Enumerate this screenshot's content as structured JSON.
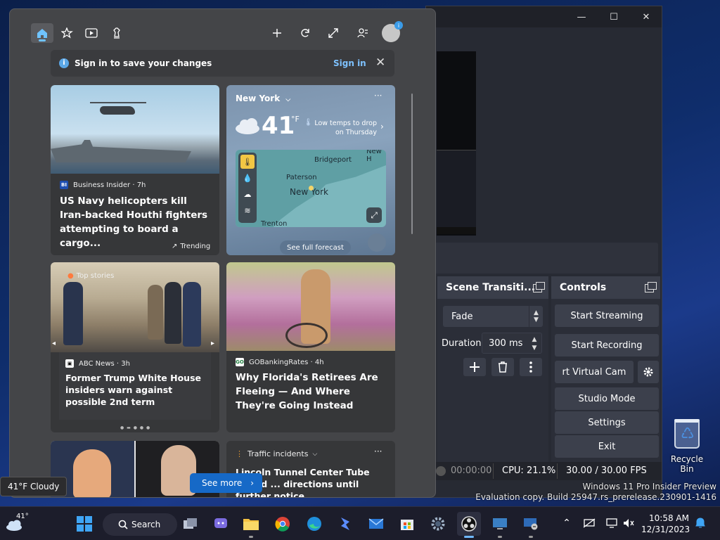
{
  "obs": {
    "window_buttons": {
      "minimize": "—",
      "maximize": "☐",
      "close": "✕"
    },
    "transitions": {
      "title": "Scene Transiti...",
      "selected": "Fade",
      "duration_label": "Duration",
      "duration_value": "300 ms"
    },
    "controls": {
      "title": "Controls",
      "buttons": [
        "Start Streaming",
        "Start Recording",
        "rt Virtual Cam",
        "Studio Mode",
        "Settings",
        "Exit"
      ]
    },
    "status": {
      "rec_time": "00:00:00",
      "cpu": "CPU: 21.1%",
      "fps": "30.00 / 30.00 FPS"
    }
  },
  "desktop": {
    "recycle_bin_label": "Recycle Bin",
    "watermark": [
      "Windows 11 Pro Insider Preview",
      "Evaluation copy. Build 25947.rs_prerelease.230901-1416"
    ]
  },
  "widgets": {
    "signin_bar": {
      "text": "Sign in to save your changes",
      "link": "Sign in"
    },
    "cards": {
      "navy": {
        "source": "Business Insider · 7h",
        "source_logo": "BI",
        "headline": "US Navy helicopters kill Iran-backed Houthi fighters attempting to board a cargo...",
        "tag": "Trending"
      },
      "weather": {
        "location": "New York",
        "temp": "41",
        "unit": "°F",
        "note_line1": "Low temps to drop",
        "note_line2": "on Thursday",
        "map_labels": {
          "bridgeport": "Bridgeport",
          "paterson": "Paterson",
          "newyork": "New York",
          "newh": "New H",
          "trenton": "Trenton"
        },
        "see_forecast": "See full forecast"
      },
      "trump": {
        "badge": "Top stories",
        "source": "ABC News · 3h",
        "headline": "Former Trump White House insiders warn against possible 2nd term"
      },
      "florida": {
        "source": "GOBankingRates · 4h",
        "source_logo": "GO",
        "headline": "Why Florida's Retirees Are Fleeing — And Where They're Going Instead"
      },
      "traffic": {
        "category": "Traffic incidents",
        "headline": "Lincoln Tunnel Center Tube closed ... directions until further notice..."
      }
    },
    "see_more": "See more",
    "tooltip": "41°F Cloudy"
  },
  "taskbar": {
    "weather_temp": "41°",
    "search_label": "Search",
    "time": "10:58 AM",
    "date": "12/31/2023"
  }
}
